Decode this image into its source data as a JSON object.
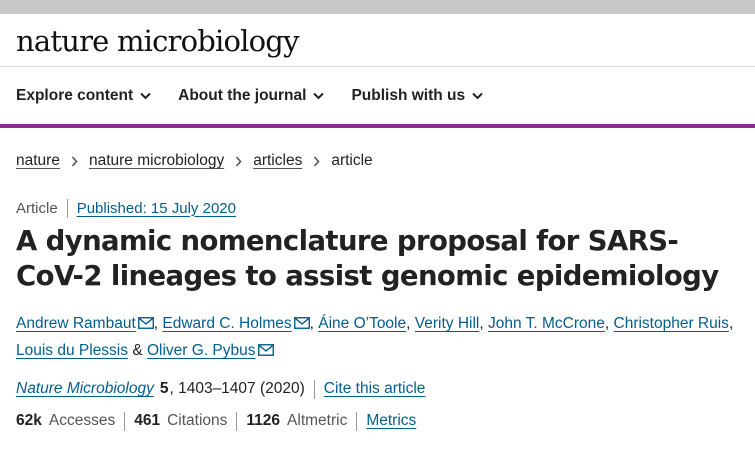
{
  "site": {
    "logo": "nature microbiology"
  },
  "nav": {
    "items": [
      {
        "label": "Explore content"
      },
      {
        "label": "About the journal"
      },
      {
        "label": "Publish with us"
      }
    ]
  },
  "breadcrumb": {
    "items": [
      "nature",
      "nature microbiology",
      "articles"
    ],
    "current": "article"
  },
  "article": {
    "type": "Article",
    "published": "Published: 15 July 2020",
    "title": "A dynamic nomenclature proposal for SARS-CoV-2 lineages to assist genomic epidemiology",
    "authors": [
      {
        "name": "Andrew Rambaut",
        "email": true
      },
      {
        "name": "Edward C. Holmes",
        "email": true
      },
      {
        "name": "Áine O’Toole",
        "email": false
      },
      {
        "name": "Verity Hill",
        "email": false
      },
      {
        "name": "John T. McCrone",
        "email": false
      },
      {
        "name": "Christopher Ruis",
        "email": false
      },
      {
        "name": "Louis du Plessis",
        "email": false
      },
      {
        "name": "Oliver G. Pybus",
        "email": true
      }
    ],
    "author_separator": ",",
    "author_last_separator": "&",
    "journal": "Nature Microbiology",
    "volume": "5",
    "pages": ", 1403–1407 (2020)",
    "cite_label": "Cite this article"
  },
  "metrics": {
    "accesses_value": "62k",
    "accesses_label": "Accesses",
    "citations_value": "461",
    "citations_label": "Citations",
    "altmetric_value": "1126",
    "altmetric_label": "Altmetric",
    "metrics_link": "Metrics"
  },
  "colors": {
    "accent_bar": "#8b2c8f",
    "link": "#025e8d",
    "top_strip": "#c8c8c8"
  }
}
